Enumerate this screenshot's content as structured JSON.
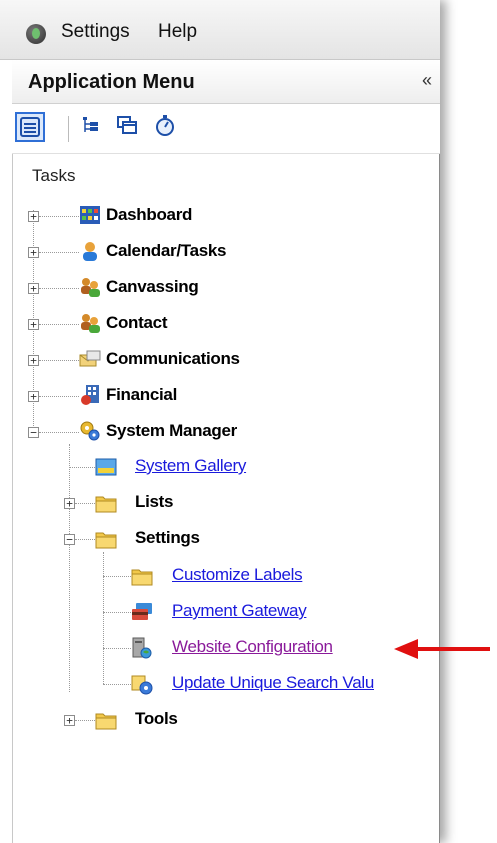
{
  "menubar": {
    "items": [
      "Settings",
      "Help"
    ]
  },
  "panel": {
    "title": "Application Menu",
    "collapse_glyph": "«"
  },
  "toolbar": {
    "icons": [
      "list-view-icon",
      "tree-view-icon",
      "windows-icon",
      "stopwatch-icon"
    ]
  },
  "tasks_label": "Tasks",
  "tree": {
    "dashboard": "Dashboard",
    "calendar": "Calendar/Tasks",
    "canvassing": "Canvassing",
    "contact": "Contact",
    "communications": "Communications",
    "financial": "Financial",
    "system_manager": "System Manager",
    "system_gallery": "System Gallery",
    "lists": "Lists",
    "settings": "Settings",
    "customize_labels": "Customize Labels",
    "payment_gateway": "Payment Gateway",
    "website_configuration": "Website Configuration",
    "update_unique": "Update Unique Search Valu",
    "tools": "Tools"
  },
  "colors": {
    "link": "#1a1adc",
    "visited_link": "#8a1a9a",
    "arrow": "#e01010"
  }
}
